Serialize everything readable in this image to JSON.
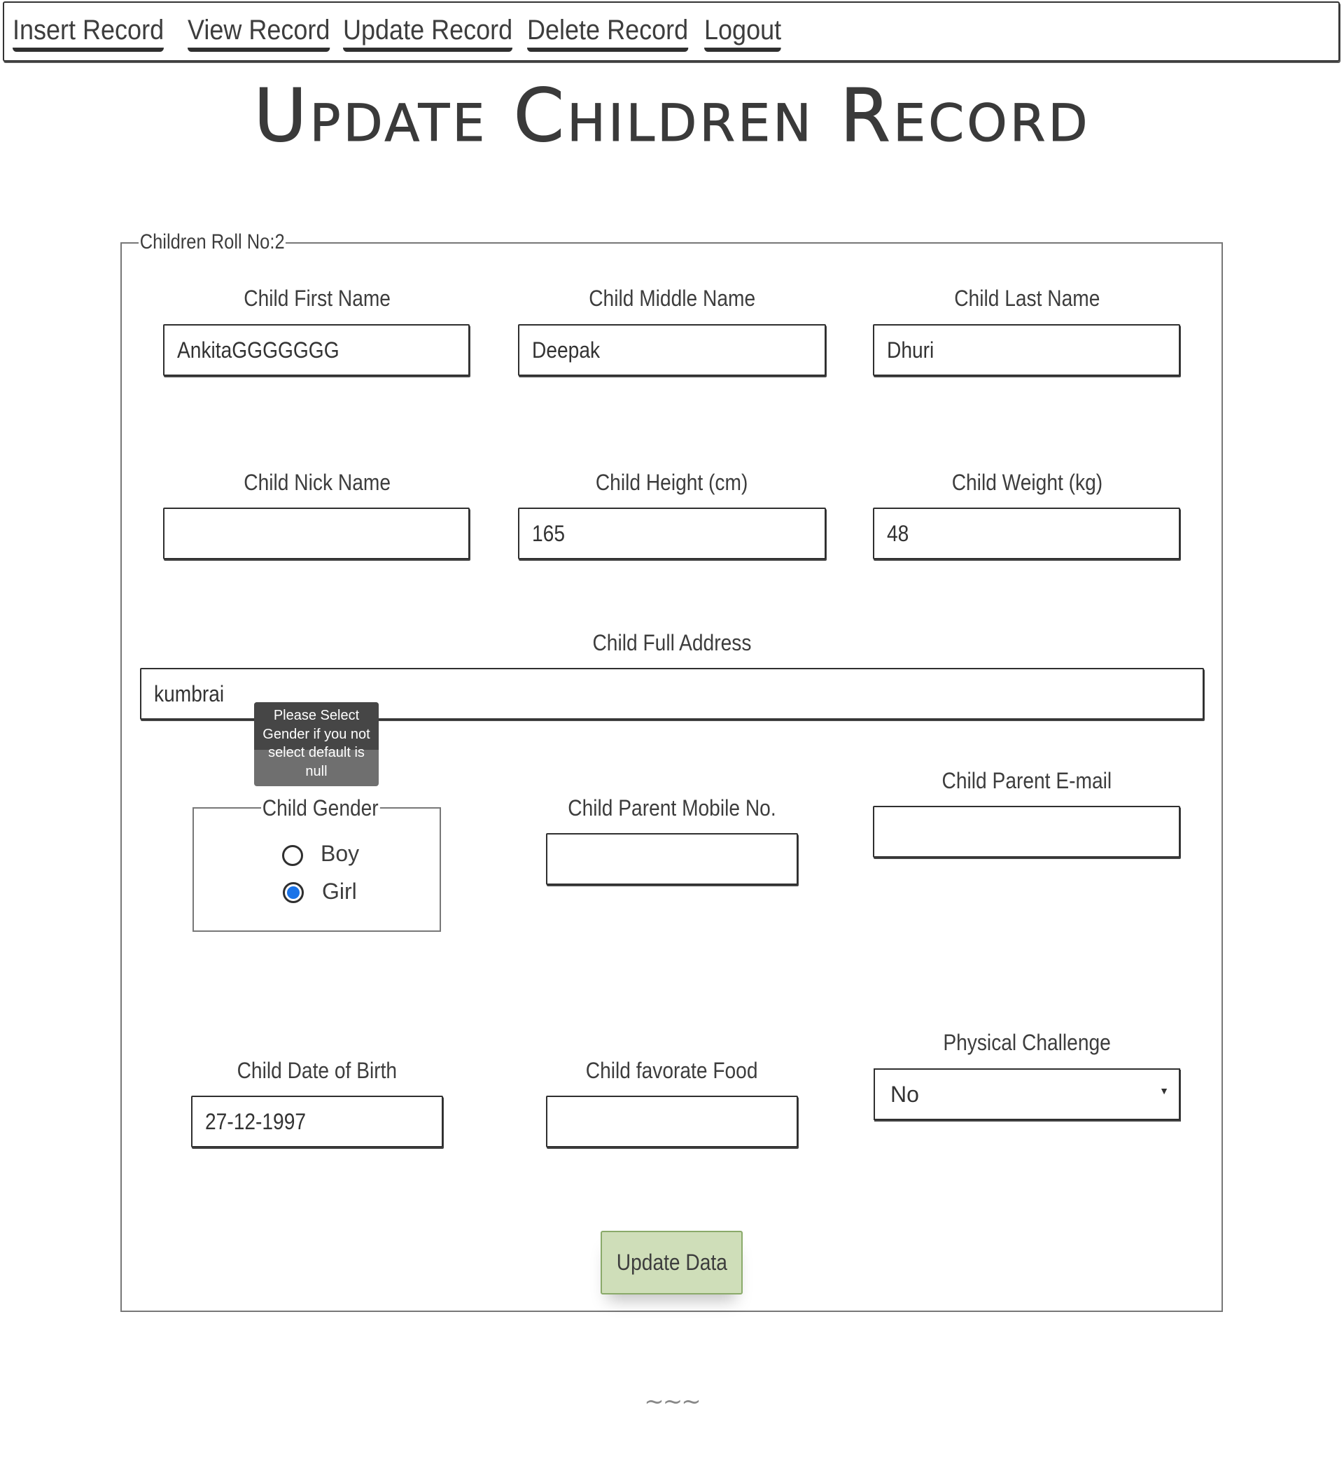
{
  "nav": {
    "items": [
      {
        "label": "Insert Record"
      },
      {
        "label": "View Record"
      },
      {
        "label": "Update Record"
      },
      {
        "label": "Delete Record"
      },
      {
        "label": "Logout"
      }
    ]
  },
  "page": {
    "title": "Update Children Record"
  },
  "form": {
    "legend": "Children Roll No:2",
    "first_name": {
      "label": "Child First Name",
      "value": "AnkitaGGGGGGG"
    },
    "middle_name": {
      "label": "Child Middle Name",
      "value": "Deepak"
    },
    "last_name": {
      "label": "Child Last Name",
      "value": "Dhuri"
    },
    "nick_name": {
      "label": "Child Nick Name",
      "value": ""
    },
    "height": {
      "label": "Child Height (cm)",
      "value": "165"
    },
    "weight": {
      "label": "Child Weight (kg)",
      "value": "48"
    },
    "address": {
      "label": "Child Full Address",
      "value": "kumbrai"
    },
    "gender": {
      "legend": "Child Gender",
      "options": [
        {
          "label": "Boy",
          "checked": false
        },
        {
          "label": "Girl",
          "checked": true
        }
      ],
      "tooltip": "Please Select Gender if you not select default is null"
    },
    "parent_mobile": {
      "label": "Child Parent Mobile No.",
      "value": ""
    },
    "parent_email": {
      "label": "Child Parent E-mail",
      "value": ""
    },
    "dob": {
      "label": "Child Date of Birth",
      "value": "27-12-1997"
    },
    "food": {
      "label": "Child favorate Food",
      "value": ""
    },
    "physical_challenge": {
      "label": "Physical Challenge",
      "selected": "No",
      "arrow": "▼"
    },
    "submit_label": "Update Data"
  },
  "footer": {
    "mark": "~~~"
  },
  "colors": {
    "button_bg": "#cfdeb9",
    "button_border": "#8aaa6a",
    "radio_accent": "#1a73e8",
    "tooltip_bg": "#6f6f6f"
  }
}
